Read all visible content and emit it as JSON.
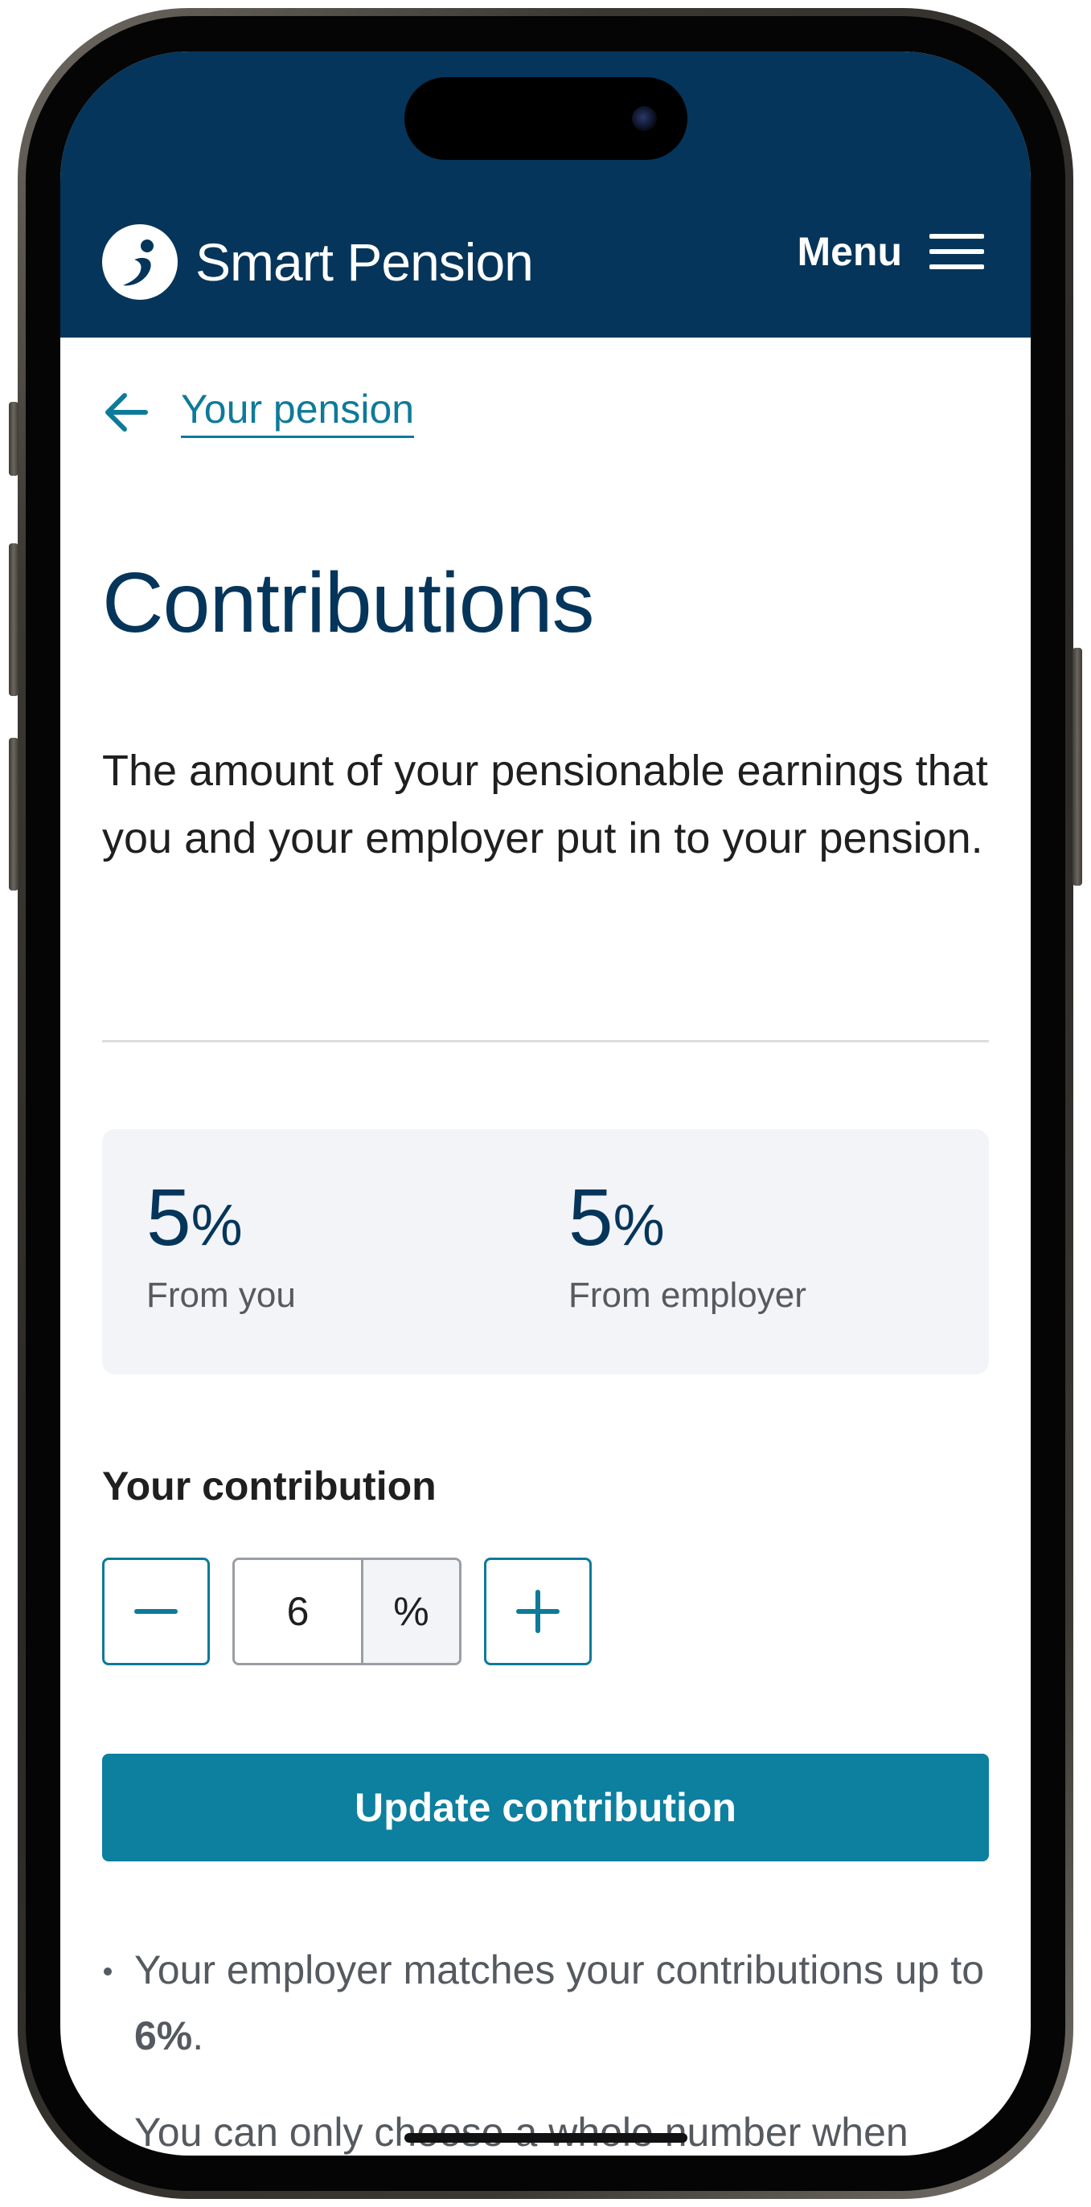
{
  "header": {
    "brand_name": "Smart Pension",
    "menu_label": "Menu"
  },
  "breadcrumb": {
    "back_label": "Your pension"
  },
  "page": {
    "title": "Contributions",
    "intro": "The amount of your pensionable earnings that you and your employer put in to your pension."
  },
  "summary": {
    "you": {
      "value": "5",
      "unit": "%",
      "label": "From you"
    },
    "employer": {
      "value": "5",
      "unit": "%",
      "label": "From employer"
    }
  },
  "contribution": {
    "label": "Your contribution",
    "value": "6",
    "unit": "%",
    "decrease_icon": "minus-icon",
    "increase_icon": "plus-icon"
  },
  "actions": {
    "update_label": "Update contribution"
  },
  "notes": {
    "match_prefix": "Your employer matches your contributions up to ",
    "match_value": "6%",
    "match_suffix": ".",
    "whole_number": "You can only choose a whole number when entering a contribution percentage."
  },
  "colors": {
    "header_bg": "#05355a",
    "accent": "#0d7f9f",
    "title": "#05355a",
    "card_bg": "#f3f4f8"
  }
}
